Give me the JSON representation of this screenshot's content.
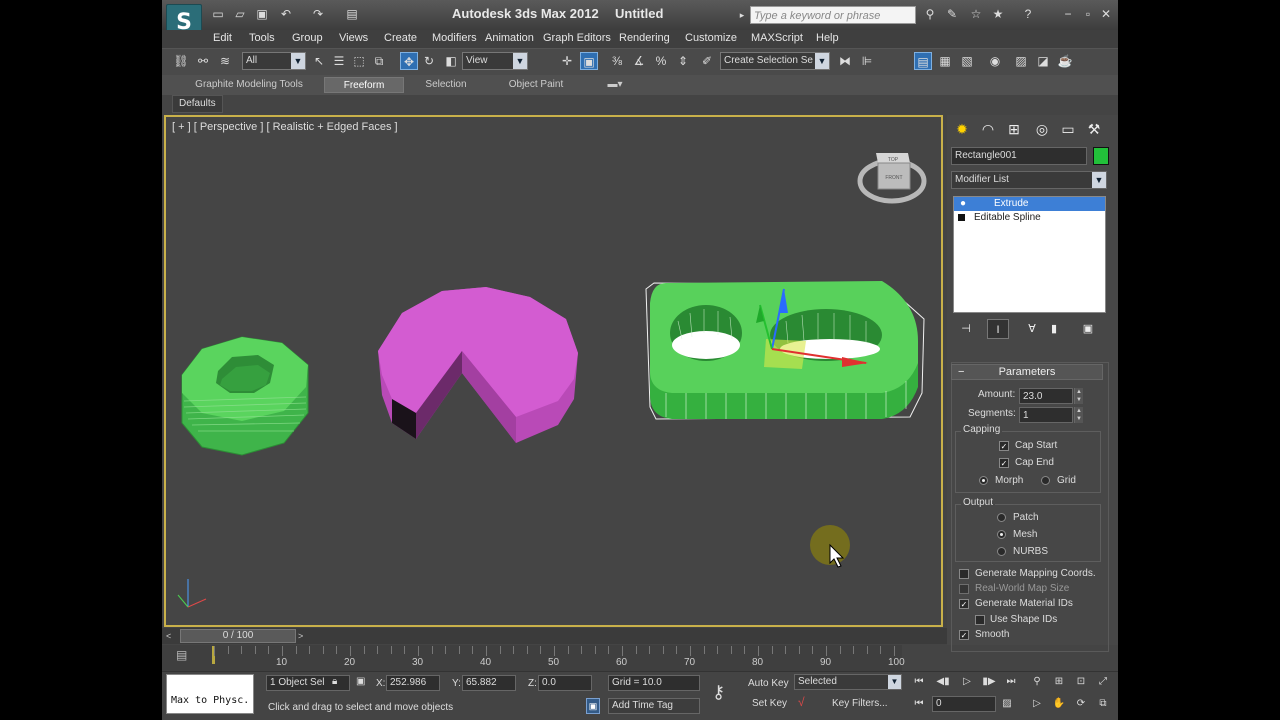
{
  "app": {
    "title": "Autodesk 3ds Max  2012",
    "document": "Untitled",
    "search_placeholder": "Type a keyword or phrase"
  },
  "menu": [
    "Edit",
    "Tools",
    "Group",
    "Views",
    "Create",
    "Modifiers",
    "Animation",
    "Graph Editors",
    "Rendering",
    "Customize",
    "MAXScript",
    "Help"
  ],
  "toolbar": {
    "filter": "All",
    "refcoord": "View",
    "selection_set": "Create Selection Se"
  },
  "ribbon": {
    "tabs": [
      "Graphite Modeling Tools",
      "Freeform",
      "Selection",
      "Object Paint"
    ],
    "active": "Freeform",
    "defaults": "Defaults"
  },
  "viewport": {
    "label": "[ + ] [ Perspective ] [ Realistic + Edged Faces ]",
    "viewcube_top": "TOP",
    "viewcube_front": "FRONT"
  },
  "command_panel": {
    "object_name": "Rectangle001",
    "object_color": "#22c03a",
    "modifier_list": "Modifier List",
    "stack": [
      "Extrude",
      "Editable Spline"
    ],
    "parameters": {
      "title": "Parameters",
      "amount_label": "Amount:",
      "amount": "23.0",
      "segments_label": "Segments:",
      "segments": "1",
      "capping_label": "Capping",
      "cap_start": "Cap Start",
      "cap_end": "Cap End",
      "morph": "Morph",
      "grid": "Grid",
      "output_label": "Output",
      "patch": "Patch",
      "mesh": "Mesh",
      "nurbs": "NURBS",
      "gen_mapping": "Generate Mapping Coords.",
      "real_world": "Real-World Map Size",
      "gen_matids": "Generate Material IDs",
      "use_shape_ids": "Use Shape IDs",
      "smooth": "Smooth"
    }
  },
  "timeline": {
    "frame": "0 / 100",
    "ticks": [
      "10",
      "20",
      "30",
      "40",
      "50",
      "60",
      "70",
      "80",
      "90",
      "100"
    ]
  },
  "status": {
    "maxscript": "Max to Physc.",
    "selected": "1 Object Sel",
    "x_label": "X:",
    "x": "252.986",
    "y_label": "Y:",
    "y": "65.882",
    "z_label": "Z:",
    "z": "0.0",
    "grid": "Grid = 10.0",
    "prompt": "Click and drag to select and move objects",
    "add_time_tag": "Add Time Tag",
    "auto_key": "Auto Key",
    "set_key": "Set Key",
    "key_mode": "Selected",
    "key_filters": "Key Filters...",
    "current_frame": "0"
  }
}
